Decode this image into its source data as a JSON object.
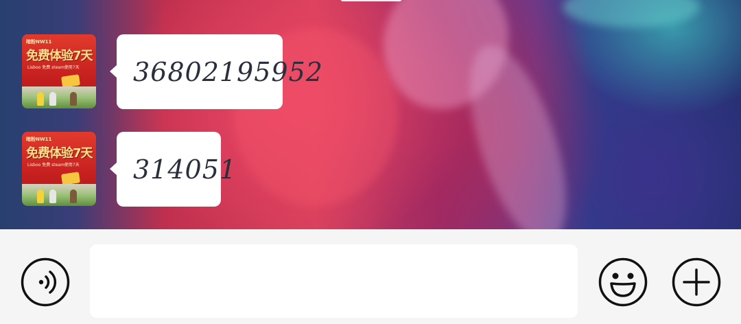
{
  "chat": {
    "messages": [
      {
        "sender_avatar": {
          "icon": "promo-avatar",
          "headline": "免费",
          "headline2": "体验7天",
          "top_text": "暗粉NW11",
          "sub_text": "Lisboo 免费 steam使用7天"
        },
        "text": "36802195952"
      },
      {
        "sender_avatar": {
          "icon": "promo-avatar",
          "headline": "免费",
          "headline2": "体验7天",
          "top_text": "暗粉NW11",
          "sub_text": "Lisboo 免费 steam使用7天"
        },
        "text": "314051"
      }
    ]
  },
  "input_bar": {
    "voice_icon": "voice-icon",
    "message_value": "",
    "message_placeholder": "",
    "emoji_icon": "emoji-icon",
    "plus_icon": "plus-icon"
  },
  "colors": {
    "bubble": "#ffffff",
    "input_bar_bg": "#f5f5f5",
    "icon_stroke": "#111111",
    "message_text": "#2b2f3c"
  }
}
